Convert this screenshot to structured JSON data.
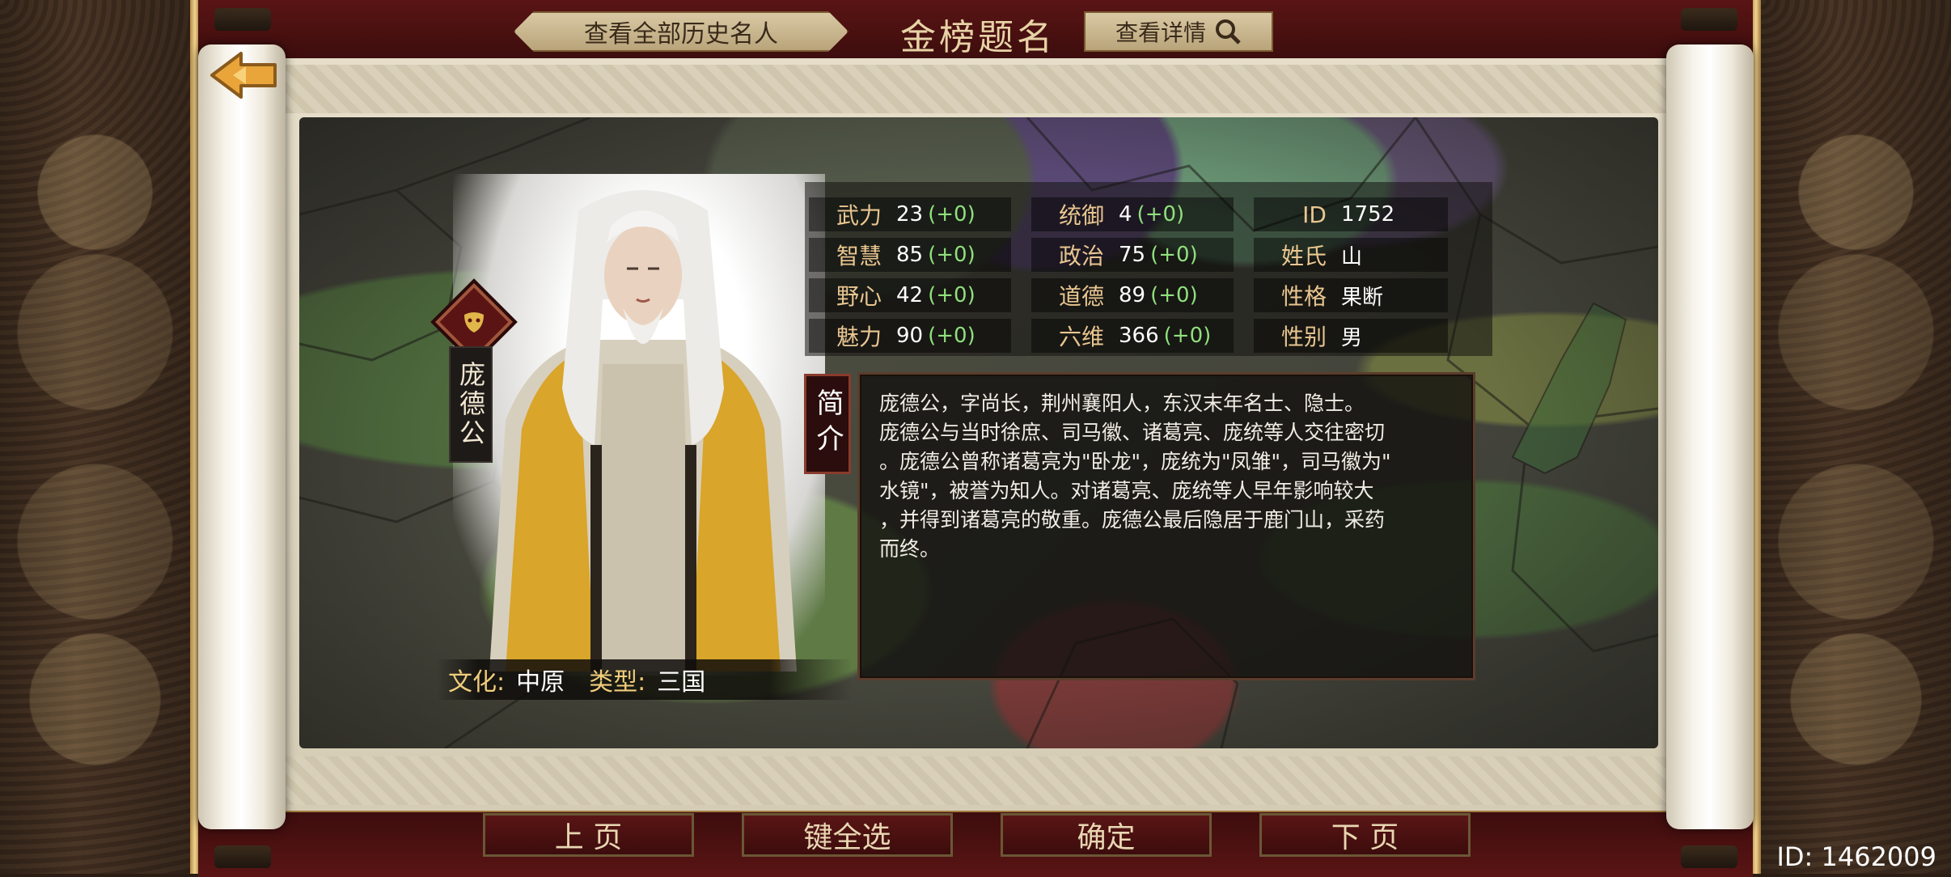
{
  "header": {
    "view_all_button": "查看全部历史名人",
    "title": "金榜题名",
    "details_button": "查看详情"
  },
  "character": {
    "name": "庞德公",
    "stats": [
      {
        "label": "武力",
        "value": "23",
        "bonus": "(+0)"
      },
      {
        "label": "统御",
        "value": "4",
        "bonus": "(+0)"
      },
      {
        "label": "ID",
        "value": "1752",
        "bonus": ""
      },
      {
        "label": "智慧",
        "value": "85",
        "bonus": "(+0)"
      },
      {
        "label": "政治",
        "value": "75",
        "bonus": "(+0)"
      },
      {
        "label": "姓氏",
        "value": "山",
        "bonus": ""
      },
      {
        "label": "野心",
        "value": "42",
        "bonus": "(+0)"
      },
      {
        "label": "道德",
        "value": "89",
        "bonus": "(+0)"
      },
      {
        "label": "性格",
        "value": "果断",
        "bonus": ""
      },
      {
        "label": "魅力",
        "value": "90",
        "bonus": "(+0)"
      },
      {
        "label": "六维",
        "value": "366",
        "bonus": "(+0)"
      },
      {
        "label": "性别",
        "value": "男",
        "bonus": ""
      }
    ],
    "intro_tag": "简介",
    "intro_lines": [
      "庞德公，字尚长，荆州襄阳人，东汉末年名士、隐士。",
      "庞德公与当时徐庶、司马徽、诸葛亮、庞统等人交往密切",
      "。庞德公曾称诸葛亮为\"卧龙\"，庞统为\"凤雏\"，司马徽为\"",
      "水镜\"，被誉为知人。对诸葛亮、庞统等人早年影响较大",
      "，并得到诸葛亮的敬重。庞德公最后隐居于鹿门山，采药",
      "而终。"
    ],
    "culture_label": "文化:",
    "culture_value": "中原",
    "type_label": "类型:",
    "type_value": "三国"
  },
  "footer": {
    "buttons": [
      "上 页",
      "键全选",
      "确定",
      "下 页"
    ]
  },
  "screen_id": "ID: 1462009"
}
